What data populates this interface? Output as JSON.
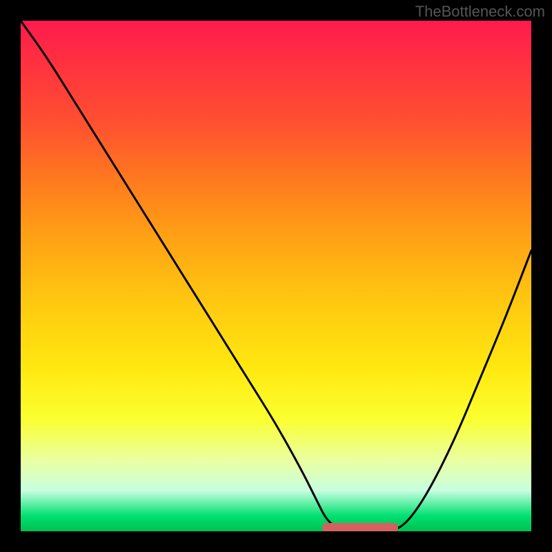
{
  "watermark": "TheBottleneck.com",
  "chart_data": {
    "type": "line",
    "title": "",
    "xlabel": "",
    "ylabel": "",
    "xlim": [
      0,
      100
    ],
    "ylim": [
      0,
      100
    ],
    "series": [
      {
        "name": "bottleneck-curve",
        "x": [
          0,
          5,
          10,
          15,
          20,
          25,
          30,
          35,
          40,
          45,
          50,
          55,
          58,
          60,
          63,
          66,
          70,
          73,
          76,
          80,
          85,
          90,
          95,
          100
        ],
        "y": [
          100,
          93,
          85,
          77,
          69,
          61,
          53,
          45,
          37,
          29,
          21,
          12,
          6,
          2,
          0,
          0,
          0,
          0,
          2,
          8,
          18,
          30,
          42,
          55
        ]
      }
    ],
    "optimum_range": {
      "start": 60,
      "end": 73,
      "y": 0
    },
    "grid": false,
    "legend": false
  }
}
